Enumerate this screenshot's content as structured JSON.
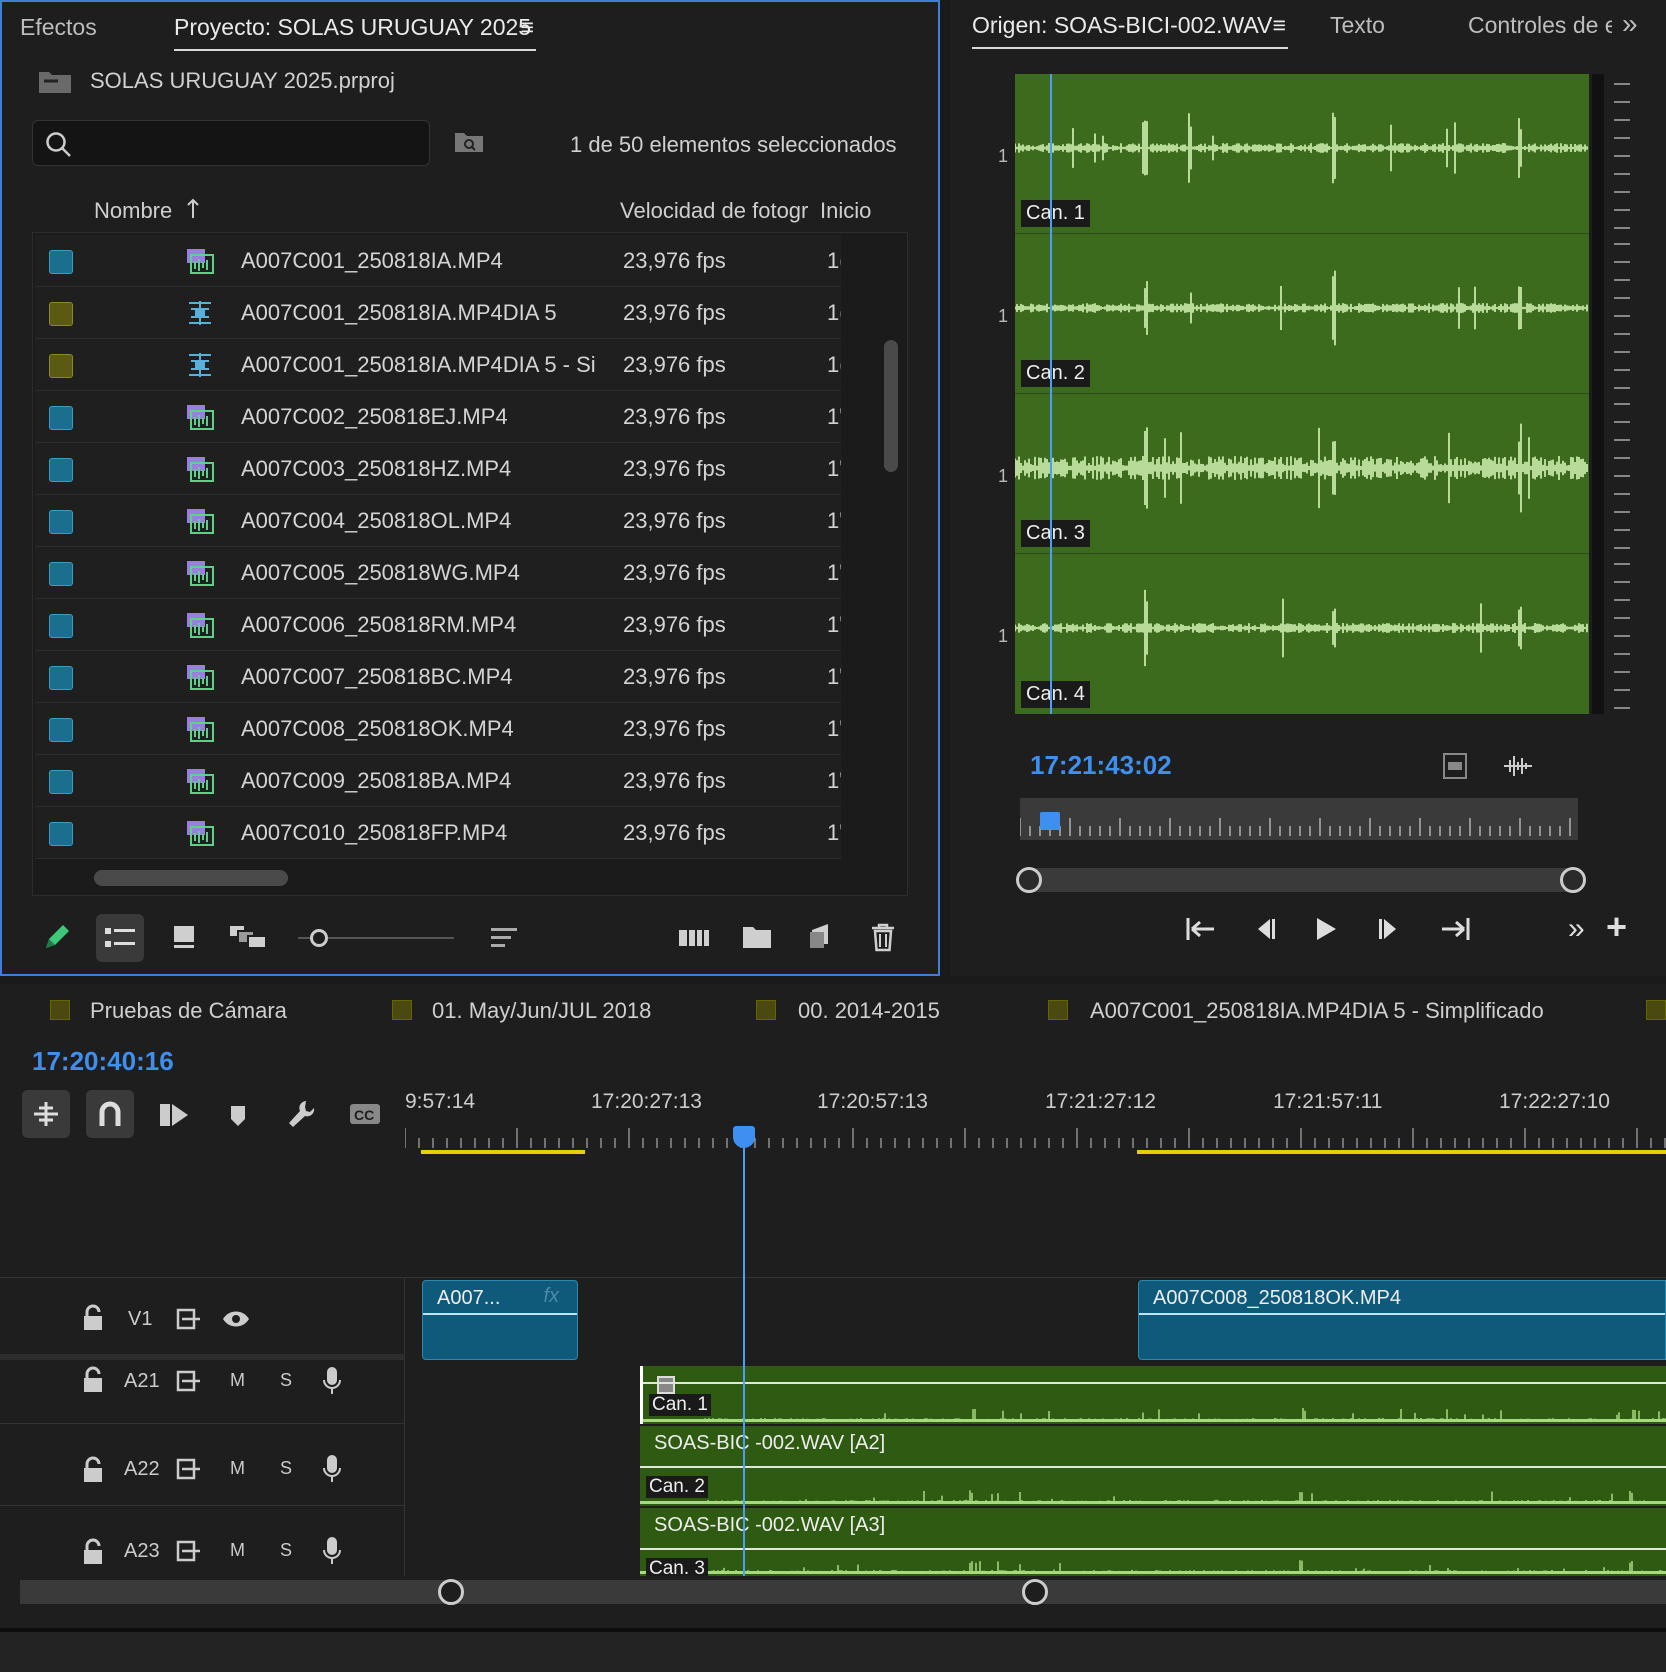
{
  "project_panel": {
    "tabs": [
      "Efectos",
      "Proyecto: SOLAS URUGUAY 2025",
      "≡"
    ],
    "project_file": "SOLAS URUGUAY 2025.prproj",
    "search_placeholder": "",
    "selection_status": "1 de 50 elementos seleccionados",
    "columns": [
      "Nombre",
      "Velocidad de fotogr",
      "Inicio"
    ],
    "rows": [
      {
        "name": "A007C001_250818IA.MP4",
        "fps": "23,976 fps",
        "start": "1(",
        "color": "#1a6e8e",
        "icon": "video-clip-icon"
      },
      {
        "name": "A007C001_250818IA.MP4DIA 5",
        "fps": "23,976 fps",
        "start": "1(",
        "color": "#5a5a12",
        "icon": "sequence-icon"
      },
      {
        "name": "A007C001_250818IA.MP4DIA 5 - Si",
        "fps": "23,976 fps",
        "start": "1(",
        "color": "#5a5a12",
        "icon": "sequence-icon"
      },
      {
        "name": "A007C002_250818EJ.MP4",
        "fps": "23,976 fps",
        "start": "1'",
        "color": "#1a6e8e",
        "icon": "video-clip-icon"
      },
      {
        "name": "A007C003_250818HZ.MP4",
        "fps": "23,976 fps",
        "start": "1'",
        "color": "#1a6e8e",
        "icon": "video-clip-icon"
      },
      {
        "name": "A007C004_250818OL.MP4",
        "fps": "23,976 fps",
        "start": "1'",
        "color": "#1a6e8e",
        "icon": "video-clip-icon"
      },
      {
        "name": "A007C005_250818WG.MP4",
        "fps": "23,976 fps",
        "start": "1'",
        "color": "#1a6e8e",
        "icon": "video-clip-icon"
      },
      {
        "name": "A007C006_250818RM.MP4",
        "fps": "23,976 fps",
        "start": "1'",
        "color": "#1a6e8e",
        "icon": "video-clip-icon"
      },
      {
        "name": "A007C007_250818BC.MP4",
        "fps": "23,976 fps",
        "start": "1'",
        "color": "#1a6e8e",
        "icon": "video-clip-icon"
      },
      {
        "name": "A007C008_250818OK.MP4",
        "fps": "23,976 fps",
        "start": "1'",
        "color": "#1a6e8e",
        "icon": "video-clip-icon"
      },
      {
        "name": "A007C009_250818BA.MP4",
        "fps": "23,976 fps",
        "start": "1'",
        "color": "#1a6e8e",
        "icon": "video-clip-icon"
      },
      {
        "name": "A007C010_250818FP.MP4",
        "fps": "23,976 fps",
        "start": "1'",
        "color": "#1a6e8e",
        "icon": "video-clip-icon"
      }
    ]
  },
  "source_panel": {
    "tabs": [
      "Origen: SOAS-BICI-002.WAV",
      "≡",
      "Texto",
      "Controles de ef",
      "»"
    ],
    "channels": [
      "Can. 1",
      "Can. 2",
      "Can. 3",
      "Can. 4"
    ],
    "channel_numbers": [
      "1",
      "1",
      "1",
      "1"
    ],
    "timecode": "17:21:43:02",
    "accent_color": "#3f8ff0",
    "waveform_bg": "#3c6b1e"
  },
  "timeline": {
    "sequence_tabs": [
      "Pruebas de Cámara",
      "01. May/Jun/JUL 2018",
      "00. 2014-2015",
      "A007C001_250818IA.MP4DIA 5 - Simplificado"
    ],
    "timecode": "17:20:40:16",
    "ruler_labels": [
      "9:57:14",
      "17:20:27:13",
      "17:20:57:13",
      "17:21:27:12",
      "17:21:57:11",
      "17:22:27:10"
    ],
    "tracks": [
      {
        "name": "V1"
      },
      {
        "name": "A21",
        "m": "M",
        "s": "S"
      },
      {
        "name": "A22",
        "m": "M",
        "s": "S"
      },
      {
        "name": "A23",
        "m": "M",
        "s": "S"
      }
    ],
    "clips": {
      "v1_a": "A007...",
      "v1_a_fx": "fx",
      "v1_b": "A007C008_250818OK.MP4",
      "a21_chan": "Can. 1",
      "a22_title": "SOAS-BIC -002.WAV [A2]",
      "a22_chan": "Can. 2",
      "a23_title": "SOAS-BIC -002.WAV [A3]",
      "a23_chan": "Can. 3"
    },
    "clip_video_color": "#0f5a7a",
    "clip_audio_color": "#2f5a12"
  }
}
